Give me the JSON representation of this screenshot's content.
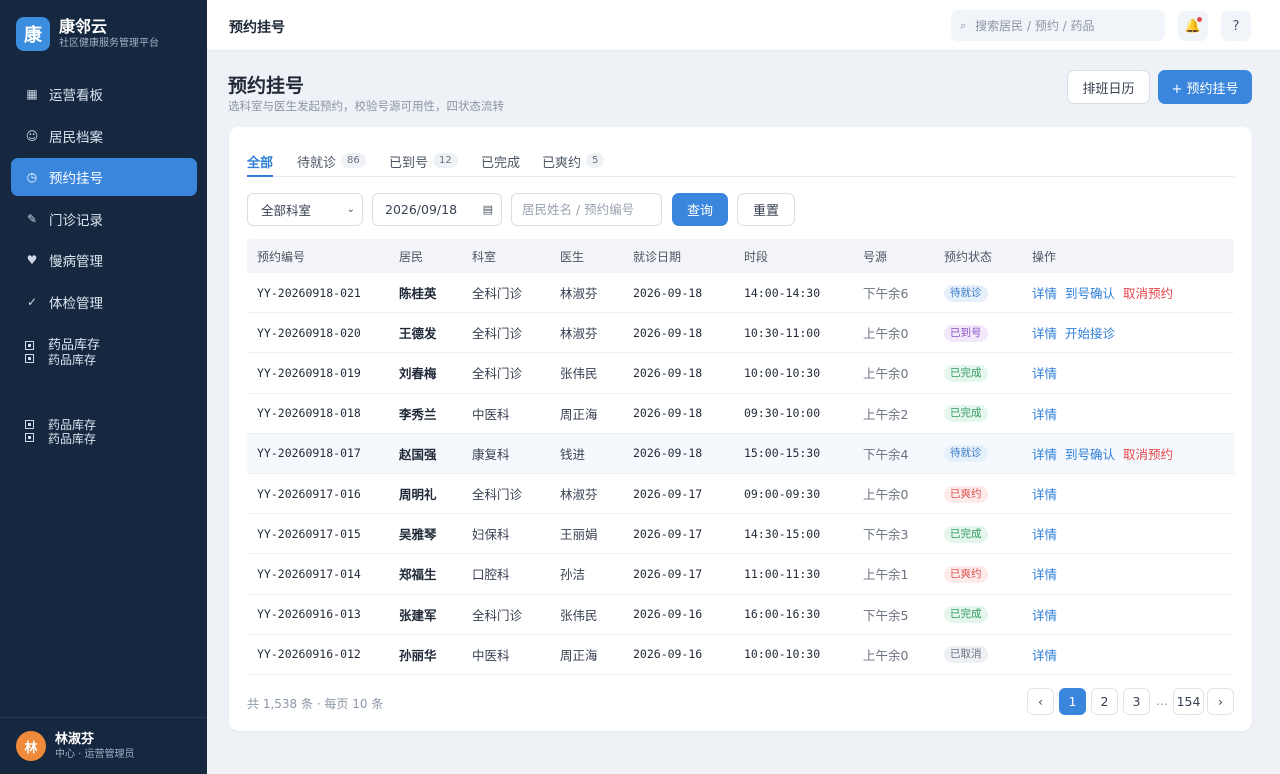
{
  "brand": {
    "logo_char": "康",
    "name": "康邻云",
    "subtitle": "社区健康服务管理平台"
  },
  "nav": [
    {
      "label": "运营看板",
      "icon": "▦"
    },
    {
      "label": "居民档案",
      "icon": "☺"
    },
    {
      "label": "预约挂号",
      "icon": "◷",
      "active": true
    },
    {
      "label": "门诊记录",
      "icon": "✎"
    },
    {
      "label": "慢病管理",
      "icon": "♥"
    },
    {
      "label": "体检管理",
      "icon": "✓"
    }
  ],
  "nav_extra": [
    {
      "line1": "药品库存",
      "line2": "药品库存"
    },
    {
      "line1": "药品库存",
      "line2": "药品库存"
    }
  ],
  "user": {
    "avatar_char": "林",
    "name": "林淑芬",
    "role": "中心 · 运营管理员"
  },
  "topbar": {
    "title": "预约挂号",
    "search_placeholder": "搜索居民 / 预约 / 药品"
  },
  "header": {
    "title": "预约挂号",
    "subtitle": "选科室与医生发起预约，校验号源可用性，四状态流转",
    "calendar_button": "排班日历",
    "new_button": "+ 预约挂号"
  },
  "tabs": [
    {
      "label": "全部",
      "count": ""
    },
    {
      "label": "待就诊",
      "count": "86"
    },
    {
      "label": "已到号",
      "count": "12"
    },
    {
      "label": "已完成",
      "count": ""
    },
    {
      "label": "已爽约",
      "count": "5"
    }
  ],
  "filters": {
    "department": "全部科室",
    "date": "2026/09/18",
    "keyword_placeholder": "居民姓名 / 预约编号",
    "query_button": "查询",
    "reset_button": "重置"
  },
  "table": {
    "columns": [
      "预约编号",
      "居民",
      "科室",
      "医生",
      "就诊日期",
      "时段",
      "号源",
      "预约状态",
      "操作"
    ],
    "rows": [
      {
        "id": "YY-20260918-021",
        "resident": "陈桂英",
        "dept": "全科门诊",
        "doctor": "林淑芬",
        "date": "2026-09-18",
        "slot": "14:00-14:30",
        "source": "下午余6",
        "status": "待就诊",
        "status_type": "wait",
        "actions": [
          "详情",
          "到号确认",
          "取消预约"
        ]
      },
      {
        "id": "YY-20260918-020",
        "resident": "王德发",
        "dept": "全科门诊",
        "doctor": "林淑芬",
        "date": "2026-09-18",
        "slot": "10:30-11:00",
        "source": "上午余0",
        "status": "已到号",
        "status_type": "arrived",
        "actions": [
          "详情",
          "开始接诊"
        ]
      },
      {
        "id": "YY-20260918-019",
        "resident": "刘春梅",
        "dept": "全科门诊",
        "doctor": "张伟民",
        "date": "2026-09-18",
        "slot": "10:00-10:30",
        "source": "上午余0",
        "status": "已完成",
        "status_type": "done",
        "actions": [
          "详情"
        ]
      },
      {
        "id": "YY-20260918-018",
        "resident": "李秀兰",
        "dept": "中医科",
        "doctor": "周正海",
        "date": "2026-09-18",
        "slot": "09:30-10:00",
        "source": "上午余2",
        "status": "已完成",
        "status_type": "done",
        "actions": [
          "详情"
        ]
      },
      {
        "id": "YY-20260918-017",
        "resident": "赵国强",
        "dept": "康复科",
        "doctor": "钱进",
        "date": "2026-09-18",
        "slot": "15:00-15:30",
        "source": "下午余4",
        "status": "待就诊",
        "status_type": "wait",
        "actions": [
          "详情",
          "到号确认",
          "取消预约"
        ],
        "highlight": true
      },
      {
        "id": "YY-20260917-016",
        "resident": "周明礼",
        "dept": "全科门诊",
        "doctor": "林淑芬",
        "date": "2026-09-17",
        "slot": "09:00-09:30",
        "source": "上午余0",
        "status": "已爽约",
        "status_type": "noshow",
        "actions": [
          "详情"
        ]
      },
      {
        "id": "YY-20260917-015",
        "resident": "吴雅琴",
        "dept": "妇保科",
        "doctor": "王丽娟",
        "date": "2026-09-17",
        "slot": "14:30-15:00",
        "source": "下午余3",
        "status": "已完成",
        "status_type": "done",
        "actions": [
          "详情"
        ]
      },
      {
        "id": "YY-20260917-014",
        "resident": "郑福生",
        "dept": "口腔科",
        "doctor": "孙洁",
        "date": "2026-09-17",
        "slot": "11:00-11:30",
        "source": "上午余1",
        "status": "已爽约",
        "status_type": "noshow",
        "actions": [
          "详情"
        ]
      },
      {
        "id": "YY-20260916-013",
        "resident": "张建军",
        "dept": "全科门诊",
        "doctor": "张伟民",
        "date": "2026-09-16",
        "slot": "16:00-16:30",
        "source": "下午余5",
        "status": "已完成",
        "status_type": "done",
        "actions": [
          "详情"
        ]
      },
      {
        "id": "YY-20260916-012",
        "resident": "孙丽华",
        "dept": "中医科",
        "doctor": "周正海",
        "date": "2026-09-16",
        "slot": "10:00-10:30",
        "source": "上午余0",
        "status": "已取消",
        "status_type": "cancel",
        "actions": [
          "详情"
        ]
      }
    ]
  },
  "footer": {
    "summary": "共 1,538 条 · 每页 10 条"
  },
  "pagination": {
    "prev": "‹",
    "pages": [
      "1",
      "2",
      "3"
    ],
    "ellipsis": "…",
    "last": "154",
    "next": "›",
    "current": "1"
  },
  "colors": {
    "primary": "#3a86dd",
    "sidebar": "#16283f",
    "danger": "#e5484d"
  }
}
